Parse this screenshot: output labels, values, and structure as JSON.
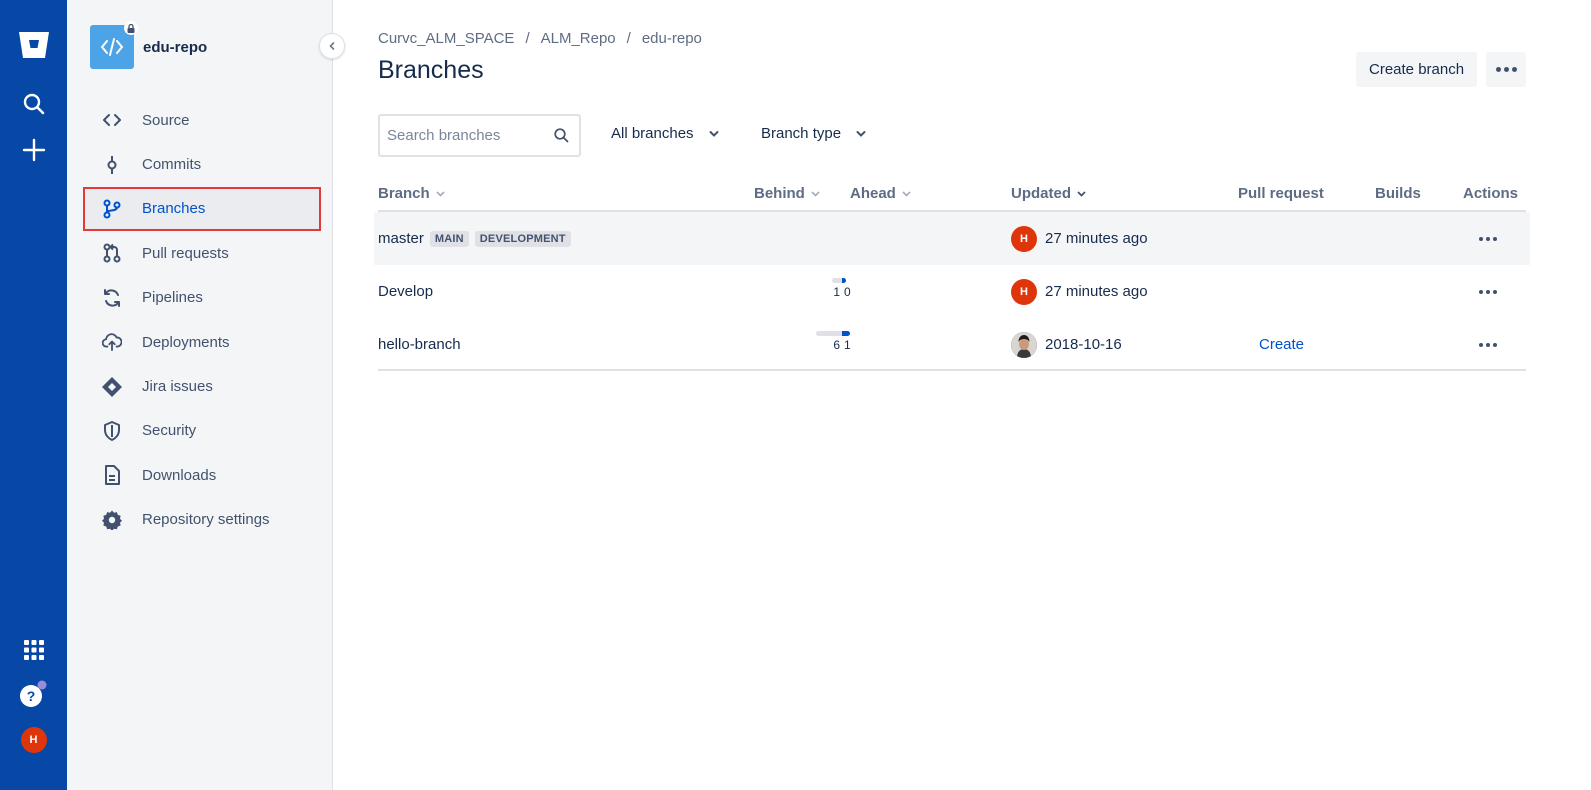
{
  "global_nav": {
    "logo_icon": "bitbucket-logo-icon",
    "search_icon": "search-icon",
    "create_icon": "plus-icon",
    "apps_icon": "app-switcher-icon",
    "help_icon": "help-icon",
    "avatar_initial": "H"
  },
  "sidebar": {
    "repo_name": "edu-repo",
    "items": [
      {
        "label": "Source",
        "icon": "source-icon"
      },
      {
        "label": "Commits",
        "icon": "commits-icon"
      },
      {
        "label": "Branches",
        "icon": "branches-icon",
        "active": true
      },
      {
        "label": "Pull requests",
        "icon": "pull-request-icon"
      },
      {
        "label": "Pipelines",
        "icon": "pipelines-icon"
      },
      {
        "label": "Deployments",
        "icon": "deployments-icon"
      },
      {
        "label": "Jira issues",
        "icon": "jira-icon"
      },
      {
        "label": "Security",
        "icon": "shield-icon"
      },
      {
        "label": "Downloads",
        "icon": "downloads-icon"
      },
      {
        "label": "Repository settings",
        "icon": "gear-icon"
      }
    ]
  },
  "breadcrumb": [
    "Curvc_ALM_SPACE",
    "ALM_Repo",
    "edu-repo"
  ],
  "breadcrumb_sep": "/",
  "page": {
    "title": "Branches",
    "create_branch_label": "Create branch"
  },
  "filters": {
    "search_placeholder": "Search branches",
    "branches_filter": "All branches",
    "type_filter": "Branch type"
  },
  "table": {
    "columns": {
      "branch": "Branch",
      "behind": "Behind",
      "ahead": "Ahead",
      "updated": "Updated",
      "pull_request": "Pull request",
      "builds": "Builds",
      "actions": "Actions"
    },
    "rows": [
      {
        "name": "master",
        "badges": [
          "MAIN",
          "DEVELOPMENT"
        ],
        "behind": "",
        "ahead": "",
        "avatar": "H",
        "updated": "27 minutes ago",
        "pull_request": ""
      },
      {
        "name": "Develop",
        "badges": [],
        "behind": "1",
        "ahead": "0",
        "avatar": "H",
        "updated": "27 minutes ago",
        "pull_request": ""
      },
      {
        "name": "hello-branch",
        "badges": [],
        "behind": "6",
        "ahead": "1",
        "avatar": "",
        "updated": "2018-10-16",
        "pull_request": "Create"
      }
    ]
  },
  "colors": {
    "global_nav": "#0747a6",
    "accent": "#0052cc",
    "avatar": "#de350b",
    "highlight_border": "#e2393b"
  }
}
